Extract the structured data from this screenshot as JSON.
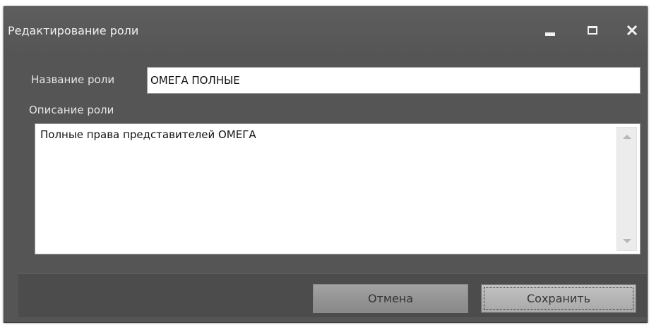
{
  "window": {
    "title": "Редактирование роли"
  },
  "titlebar_buttons": {
    "minimize_icon": "minimize-icon",
    "maximize_icon": "maximize-icon",
    "close_glyph": "✕"
  },
  "form": {
    "name_label": "Название роли",
    "name_value": "ОМЕГА ПОЛНЫЕ",
    "description_label": "Описание роли",
    "description_value": "Полные права представителей ОМЕГА"
  },
  "buttons": {
    "cancel_label": "Отмена",
    "save_label": "Сохранить"
  },
  "colors": {
    "window_bg": "#555555",
    "text_light": "#e6e6e6"
  }
}
